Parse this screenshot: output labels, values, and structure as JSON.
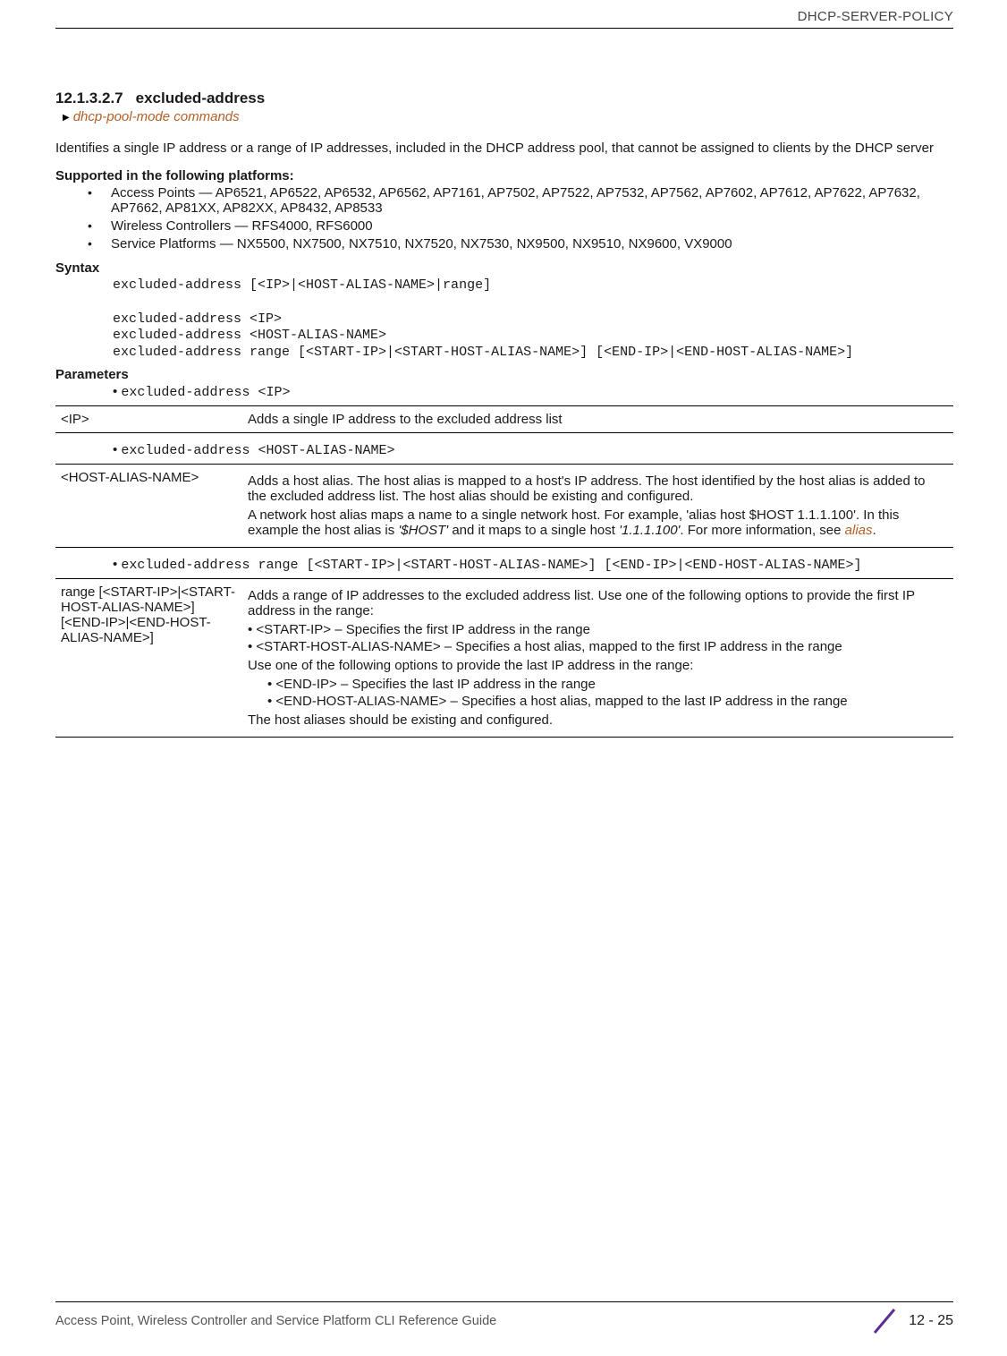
{
  "running_head": "DHCP-SERVER-POLICY",
  "section": {
    "number": "12.1.3.2.7",
    "title": "excluded-address"
  },
  "breadcrumb": "dhcp-pool-mode commands",
  "intro": "Identifies a single IP address or a range of IP addresses, included in the DHCP address pool, that cannot be assigned to clients by the DHCP server",
  "supported_heading": "Supported in the following platforms:",
  "platforms": [
    "Access Points — AP6521, AP6522, AP6532, AP6562, AP7161, AP7502, AP7522, AP7532, AP7562, AP7602, AP7612, AP7622, AP7632, AP7662, AP81XX, AP82XX, AP8432, AP8533",
    "Wireless Controllers — RFS4000, RFS6000",
    "Service Platforms — NX5500, NX7500, NX7510, NX7520, NX7530, NX9500, NX9510, NX9600, VX9000"
  ],
  "syntax_heading": "Syntax",
  "syntax_text": "excluded-address [<IP>|<HOST-ALIAS-NAME>|range]\n\nexcluded-address <IP>\nexcluded-address <HOST-ALIAS-NAME>\nexcluded-address range [<START-IP>|<START-HOST-ALIAS-NAME>] [<END-IP>|<END-HOST-ALIAS-NAME>]",
  "parameters_heading": "Parameters",
  "param1_cmd": "excluded-address <IP>",
  "param1_key": "<IP>",
  "param1_desc": "Adds a single IP address to the excluded address list",
  "param2_cmd": "excluded-address <HOST-ALIAS-NAME>",
  "param2_key": "<HOST-ALIAS-NAME>",
  "param2_desc_p1": "Adds a host alias. The host alias is mapped to a host's IP address. The host identified by the host alias is added to the excluded address list. The host alias should be existing and configured.",
  "param2_desc_p2a": "A network host alias maps a name to a single network host. For example, 'alias host $HOST 1.1.1.100'. In this example the host alias is ",
  "param2_hostvar": "'$HOST'",
  "param2_desc_p2b": " and it maps to a single host ",
  "param2_hostip": "'1.1.1.100'",
  "param2_desc_p2c": ". For more information, see ",
  "param2_link": "alias",
  "param3_cmd": "excluded-address range [<START-IP>|<START-HOST-ALIAS-NAME>] [<END-IP>|<END-HOST-ALIAS-NAME>]",
  "param3_key": "range [<START-IP>|<START-HOST-ALIAS-NAME>] [<END-IP>|<END-HOST-ALIAS-NAME>]",
  "param3_intro": "Adds a range of IP addresses to the excluded address list. Use one of the following options to provide the first IP address in the range:",
  "param3_b1": "<START-IP> – Specifies the first IP address in the range",
  "param3_b2": "<START-HOST-ALIAS-NAME> – Specifies a host alias, mapped to the first IP address in the range",
  "param3_mid": "Use one of the following options to provide the last IP address in the range:",
  "param3_b3": "<END-IP> – Specifies the last IP address in the range",
  "param3_b4": "<END-HOST-ALIAS-NAME> – Specifies a host alias, mapped to the last IP address in the range",
  "param3_end": "The host aliases should be existing and configured.",
  "footer_title": "Access Point, Wireless Controller and Service Platform CLI Reference Guide",
  "page_number": "12 - 25"
}
